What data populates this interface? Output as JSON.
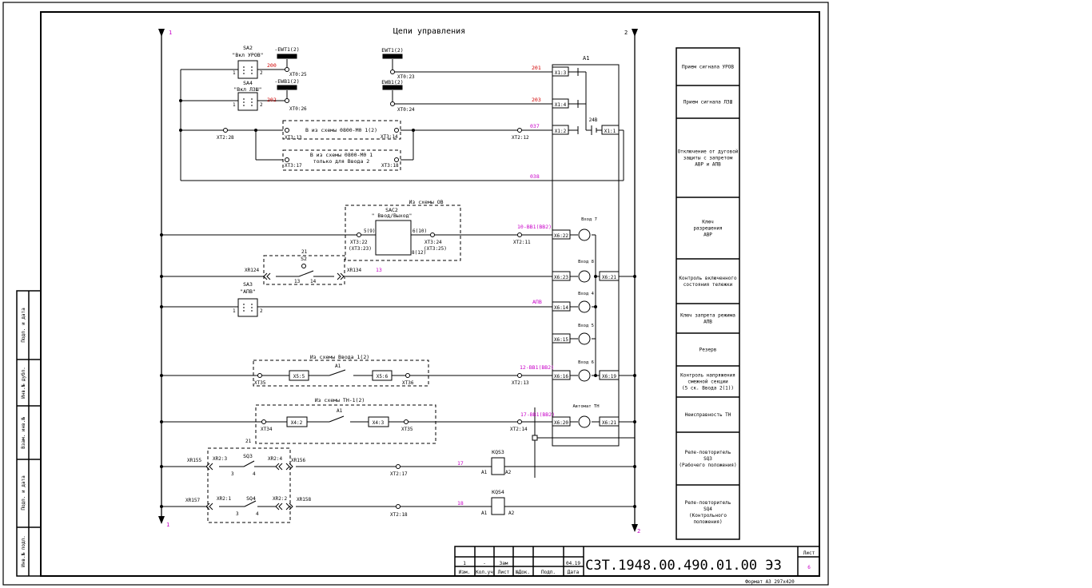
{
  "title": "Цепи управления",
  "rail_labels": {
    "left_top": "1",
    "right_top": "2",
    "left_bottom": "1",
    "right_bottom": "2"
  },
  "device_a1": "A1",
  "components": {
    "sa2_name": "SA2",
    "sa2_caption": "\"Вкл УРОВ\"",
    "sa4_name": "SA4",
    "sa4_caption": "\"Вкл ЛЗШ\"",
    "ewt": "-EWT1(2)",
    "ewb": "-EWB1(2)",
    "ewt2": "EWT1(2)",
    "ewb2": "EWB1(2)",
    "sac2_name": "SAC2",
    "sac2_caption": "\" Ввод/Выход\"",
    "sa3_name": "SA3",
    "sa3_caption": "\"АПВ\"",
    "kqs3": "KQS3",
    "kqs4": "KQS4",
    "sq3": "SQ3",
    "sq4": "SQ4",
    "s2": "S2"
  },
  "terminals": {
    "xt0_25": "XT0:25",
    "xt0_26": "XT0:26",
    "xt0_23": "XT0:23",
    "xt0_24": "XT0:24",
    "xt2_28": "XT2:28",
    "xt3_13": "XT3:13",
    "xt3_14": "XT3:14",
    "xt3_17": "XT3:17",
    "xt3_18": "XT3:18",
    "xt2_12": "XT2:12",
    "xt3_22": "XT3:22",
    "xt3_23": "(XT3:23)",
    "xt3_24": "XT3:24",
    "xt3_25": "(XT3:25)",
    "xt2_11": "XT2:11",
    "xr124": "XR124",
    "xr134": "XR134",
    "xt35a": "XT35",
    "xt36a": "XT36",
    "xt2_13": "XT2:13",
    "xt34": "XT34",
    "xt35b": "XT35",
    "xt2_14": "XT2:14",
    "xr155": "XR155",
    "xr2_3": "XR2:3",
    "xr2_4": "XR2:4",
    "xr156": "XR156",
    "xt2_17": "XT2:17",
    "xr157": "XR157",
    "xr2_1": "XR2:1",
    "xr2_2": "XR2:2",
    "xr158": "XR158",
    "xt2_18": "XT2:18"
  },
  "wires": {
    "w200": "200",
    "w202": "202",
    "w201": "201",
    "w203": "203",
    "w037": "037",
    "w038": "038",
    "w10": "10-BB1(BB2)",
    "w13": "13",
    "wapv": "АПВ",
    "w12": "12-BB1(BB2)",
    "w17v": "17-BB1(BB2)",
    "w17": "17",
    "w18": "18"
  },
  "boxes": {
    "scheme1": "В из схемы 0800-М0 1(2)",
    "scheme2a": "В из схемы 0800-М0 1",
    "scheme2b": "только для Ввода 2",
    "from_ov": "Из схемы ОВ",
    "from_vvod": "Из схемы Ввода 1(2)",
    "from_tn": "Из схемы ТН-1(2)"
  },
  "a1_ports": {
    "x1_3": "X1:3",
    "x1_4": "X1:4",
    "x1_2": "X1:2",
    "x1_1": "X1:1",
    "x6_22": "X6:22",
    "x6_23": "X6:23",
    "x6_14": "X6:14",
    "x6_15": "X6:15",
    "x6_16": "X6:16",
    "x6_20": "X6:20",
    "x6_21a": "X6:21",
    "x6_19": "X6:19",
    "x6_21b": "X6:21",
    "x5_5": "X5:5",
    "x5_6": "X5:6",
    "x4_2": "X4:2",
    "x4_3": "X4:3",
    "v24": "24В"
  },
  "inputs": {
    "in7": "Вход 7",
    "in8": "Вход 8",
    "in4": "Вход 4",
    "in5": "Вход 5",
    "in6": "Вход 6",
    "tn": "Автомат ТН"
  },
  "misc_labels": {
    "pin1": "1",
    "pin2": "2",
    "n3": "3",
    "n4": "4",
    "s5_9": "5(9)",
    "s6_10": "6(10)",
    "s8_12": "8(12)",
    "c13": "13",
    "c14": "14",
    "c21": "21",
    "a1": "A1",
    "a2": "A2"
  },
  "legend": [
    "Прием сигнала УРОВ",
    "Прием сигнала ЛЗШ",
    "Отключение от дуговой|защиты с запретом|АВР и АПВ",
    "Ключ|разрешения|АВР",
    "Контроль включенного|состояния тележки",
    "Ключ запрета режима|АПВ",
    "Резерв",
    "Контроль напряжения|смежной секции|(5 ск. Ввода 2(1))",
    "Неисправность ТН",
    "Реле-повторитель|SQ3|(Рабочего положения)",
    "Реле-повторитель|SQ4|(Контрольного|положения)"
  ],
  "side_stamp": [
    "Подп. и дата",
    "Инв.№ дубл.",
    "Взам. инв.№",
    "Подп. и дата",
    "Инв.№ подл."
  ],
  "title_block": {
    "row1": [
      "1",
      "-",
      "Зам",
      "",
      "",
      "04.19"
    ],
    "row2": [
      "Изм.",
      "Кол.уч",
      "Лист",
      "№Док.",
      "Подп.",
      "Дата"
    ],
    "doc_number": "СЗТ.1948.00.490.01.00 ЭЗ",
    "sheet_label": "Лист",
    "sheet_number": "6",
    "format": "Формат А3 297х420"
  },
  "colors": {
    "wire_label": "#d10000",
    "magenta_label": "#c800c8",
    "line": "#000000"
  }
}
